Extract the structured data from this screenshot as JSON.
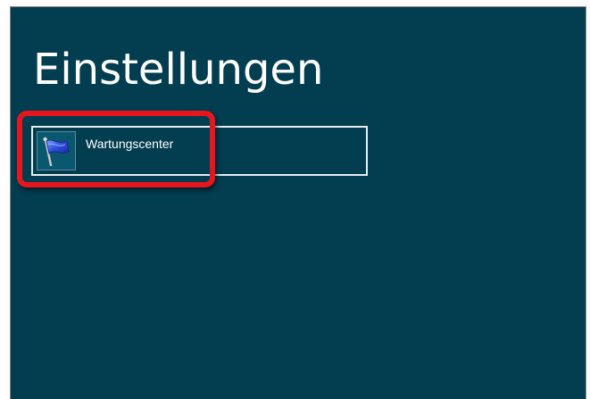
{
  "window": {
    "title": "Einstellungen"
  },
  "tiles": [
    {
      "label": "Wartungscenter",
      "icon": "flag-icon"
    }
  ],
  "colors": {
    "background": "#033d50",
    "tile_border": "#e9eef0",
    "highlight": "#e8151c"
  }
}
